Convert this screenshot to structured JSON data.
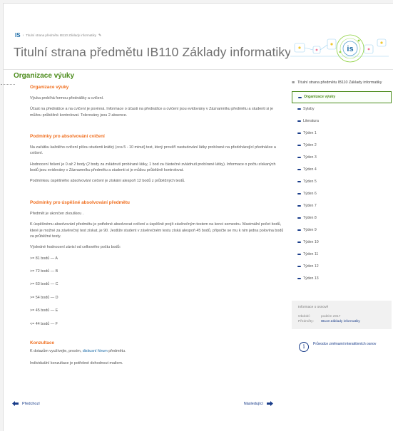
{
  "breadcrumb": {
    "logo": "IS",
    "path": "Titulní strana předmětu IB110 Základy informatiky"
  },
  "page": {
    "title": "Titulní strana předmětu IB110 Základy informatiky"
  },
  "main": {
    "section_title": "Organizace výuky",
    "blocks": {
      "org": {
        "heading": "Organizace výuky",
        "p1": "Výuka probíhá formou přednášky a cvičení.",
        "p2": "Účast na přednášce a na cvičení je povinná. Informace o účasti na přednášce a cvičení jsou evidovány v Záznamníku předmětu a studenti si je můžou průběžně kontrolovat. Tolerovány jsou 2 absence."
      },
      "conditions": {
        "heading": "Podmínky pro absolvování cvičení",
        "p1": "Na začátku každého cvičení píšou studenti krátký (cca 5 - 10 minut) test, který prověří nastudování látky probírané na předcházející přednášce a cvičení.",
        "p2": "Hodnocení řešení je 0 až 2 body (2 body za zvládnutí probírané látky, 1 bod za částečné zvládnutí probírané látky). Informace o počtu získaných bodů jsou evidovány v Záznamníku předmětu a studenti si je můžou průběžně kontrolovat.",
        "p3": "Podmínkou úspěšného absolvování cvičení je získání alespoň 12 bodů z průběžných testů."
      },
      "completion": {
        "heading": "Podmínky pro úspěšné absolvování předmětu",
        "p1": "Předmět je ukončen zkouškou .",
        "p2": "K úspěšnému absolvování předmětu je potřebné absolvovat cvičení a úspěšně projít závěrečným testem na konci semestru. Maximální počet bodů, které je možné za závěrečný test získat, je 90. Jestliže student v závěrečném testu získá alespoň 45 bodů, připočte se mu k nim jedna polovina bodů za průběžné testy.",
        "p3": "Výsledné hodnocení závisí od celkového počtu bodů:",
        "grades": [
          ">= 81 bodů  —  A",
          ">= 72 bodů  —  B",
          ">= 63 bodů  —  C",
          ">= 54 bodů  —  D",
          ">= 45 bodů  —  E",
          "<= 44 bodů  —  F"
        ]
      },
      "consult": {
        "heading": "Konzultace",
        "p1_pre": "K dotazům využívejte, prosím,",
        "p1_link": "diskusní fórum",
        "p1_post": "předmětu.",
        "p2": "Individuální konzultace je potřebné dohodnout mailem."
      }
    },
    "nav": {
      "prev": "Předchozí",
      "next": "Následující"
    }
  },
  "sidebar": {
    "toc_title": "Titulní strana předmětu IB110 Základy informatiky",
    "items": [
      "Organizace výuky",
      "Sylaby",
      "Literatura",
      "Týden 1",
      "Týden 2",
      "Týden 3",
      "Týden 4",
      "Týden 5",
      "Týden 6",
      "Týden 7",
      "Týden 8",
      "Týden 9",
      "Týden 10",
      "Týden 11",
      "Týden 12",
      "Týden 13"
    ],
    "info": {
      "title": "Informace o osnově",
      "period_label": "Období:",
      "period_value": "podzim 2017",
      "course_label": "Předměty:",
      "course_value": "IB110 Základy informatiky"
    },
    "guide": "Průvodce změnami interaktivních osnov"
  },
  "colors": {
    "accent_green": "#4c8c1c",
    "heading_orange": "#f06e1e",
    "link_blue": "#1a3d8a"
  }
}
